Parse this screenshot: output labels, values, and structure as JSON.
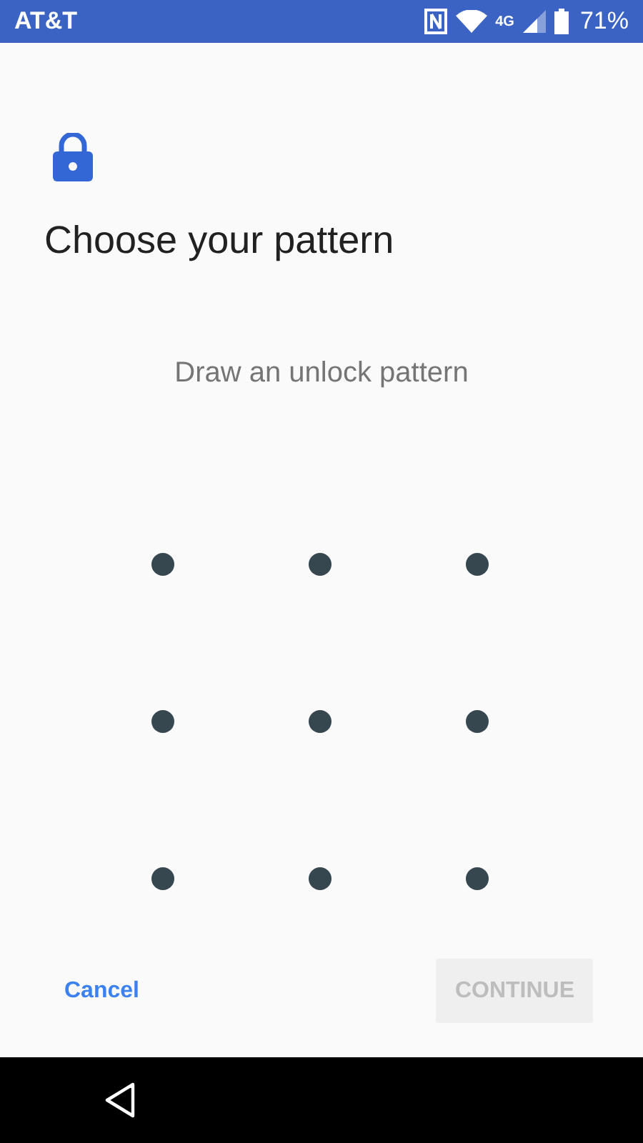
{
  "status_bar": {
    "carrier": "AT&T",
    "battery": "71%",
    "network": "4G"
  },
  "title": "Choose your pattern",
  "instruction": "Draw an unlock pattern",
  "pattern_dots": [
    {
      "selected": false
    },
    {
      "selected": false
    },
    {
      "selected": false
    },
    {
      "selected": false
    },
    {
      "selected": false
    },
    {
      "selected": false
    },
    {
      "selected": false
    },
    {
      "selected": false
    },
    {
      "selected": false
    }
  ],
  "buttons": [
    {
      "label": "Cancel",
      "kind": "text",
      "disabled": false
    },
    {
      "label": "CONTINUE",
      "kind": "filled",
      "disabled": true
    }
  ]
}
